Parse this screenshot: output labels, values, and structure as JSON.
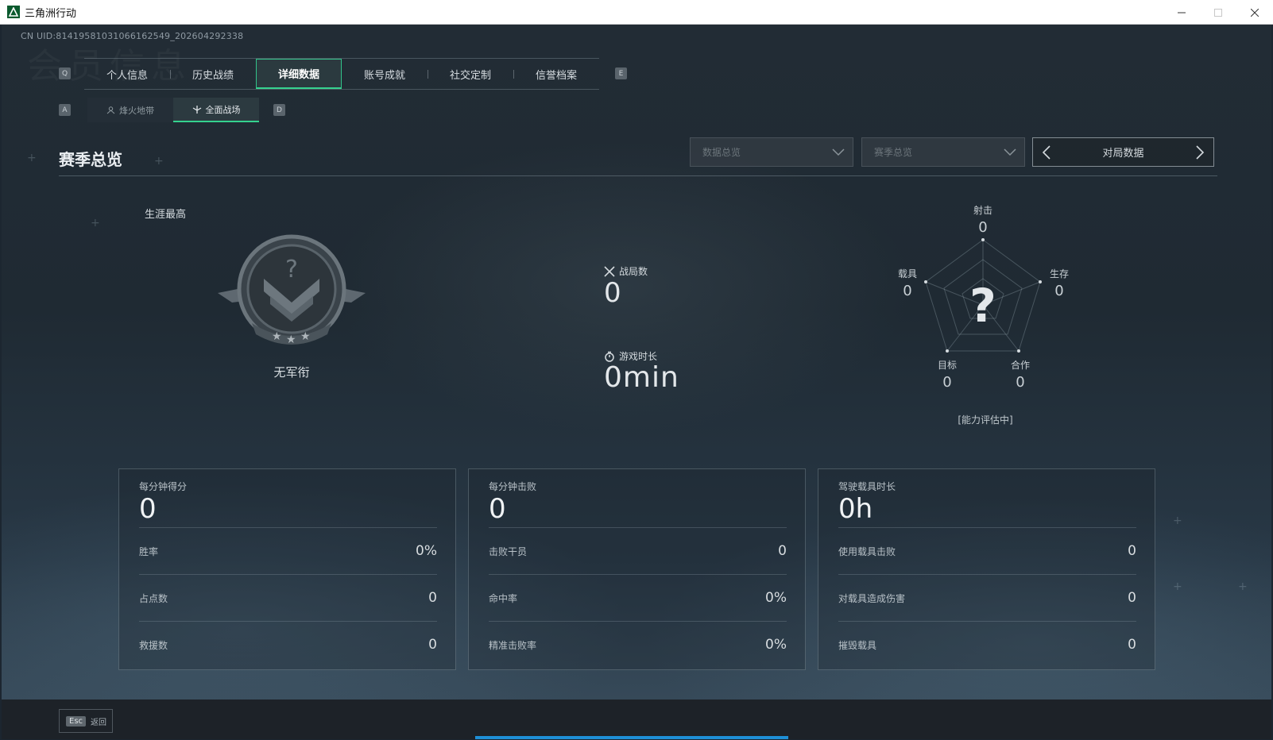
{
  "window": {
    "title": "三角洲行动",
    "minimize_icon": "minimize-icon",
    "maximize_icon": "maximize-icon",
    "close_icon": "close-icon"
  },
  "uid": "CN UID:8141958103106616254​9_202604292338",
  "watermark": "会员信息",
  "keyhints": {
    "prev_tab": "Q",
    "next_tab": "E",
    "prev_sub": "A",
    "next_sub": "D"
  },
  "tabs": [
    {
      "label": "个人信息",
      "active": false
    },
    {
      "label": "历史战绩",
      "active": false
    },
    {
      "label": "详细数据",
      "active": true
    },
    {
      "label": "账号成就",
      "active": false
    },
    {
      "label": "社交定制",
      "active": false
    },
    {
      "label": "信誉档案",
      "active": false
    }
  ],
  "subtabs": [
    {
      "label": "烽火地带",
      "active": false,
      "icon": "hazard-zone-icon"
    },
    {
      "label": "全面战场",
      "active": true,
      "icon": "warfare-icon"
    }
  ],
  "section": {
    "title": "赛季总览",
    "dropdown1": "数据总览",
    "dropdown2": "赛季总览",
    "pager_label": "对局数据"
  },
  "rank": {
    "career_label": "生涯最高",
    "name": "无军衔",
    "unknown_mark": "?"
  },
  "center_stats": {
    "matches_label": "战局数",
    "matches_value": "0",
    "playtime_label": "游戏时长",
    "playtime_value": "0min"
  },
  "radar": {
    "center_mark": "?",
    "axes": [
      {
        "label": "射击",
        "value": "0"
      },
      {
        "label": "生存",
        "value": "0"
      },
      {
        "label": "合作",
        "value": "0"
      },
      {
        "label": "目标",
        "value": "0"
      },
      {
        "label": "载具",
        "value": "0"
      }
    ],
    "note": "[能力评估中]"
  },
  "cards": [
    {
      "title": "每分钟得分",
      "value": "0",
      "rows": [
        {
          "label": "胜率",
          "value": "0%"
        },
        {
          "label": "占点数",
          "value": "0"
        },
        {
          "label": "救援数",
          "value": "0"
        }
      ]
    },
    {
      "title": "每分钟击败",
      "value": "0",
      "rows": [
        {
          "label": "击败干员",
          "value": "0"
        },
        {
          "label": "命中率",
          "value": "0%"
        },
        {
          "label": "精准击败率",
          "value": "0%"
        }
      ]
    },
    {
      "title": "驾驶载具时长",
      "value": "0h",
      "rows": [
        {
          "label": "使用载具击败",
          "value": "0"
        },
        {
          "label": "对载具造成伤害",
          "value": "0"
        },
        {
          "label": "摧毁载具",
          "value": "0"
        }
      ]
    }
  ],
  "footer": {
    "esc_key": "Esc",
    "back_label": "返回"
  },
  "colors": {
    "accent": "#35d28f",
    "progress": "#1e8fd6"
  }
}
